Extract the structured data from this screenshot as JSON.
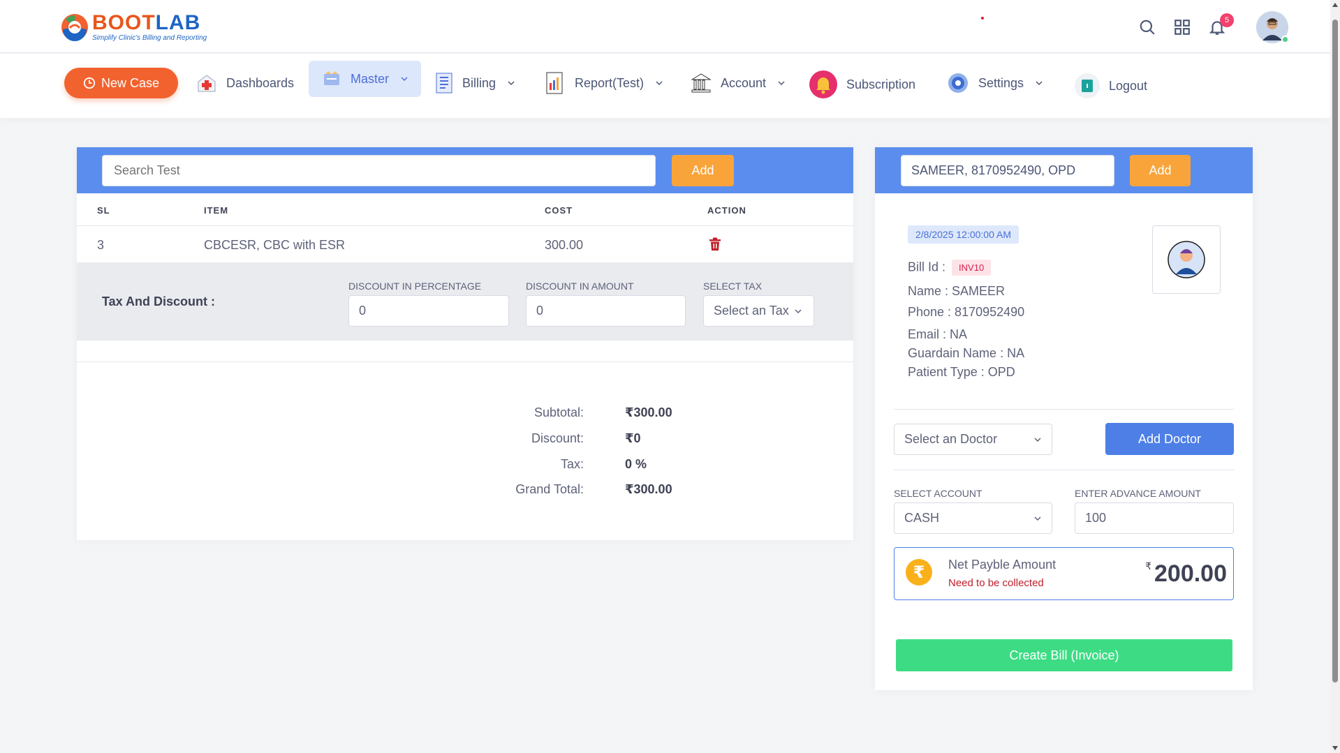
{
  "brand": {
    "name_part1": "BOOT",
    "name_part2": "LAB",
    "tagline": "Simplify Clinic's Billing and Reporting"
  },
  "header": {
    "notification_count": "5",
    "icons": [
      "search-icon",
      "grid-icon",
      "bell-icon",
      "user-avatar"
    ]
  },
  "nav": {
    "new_case": "New Case",
    "items": [
      {
        "label": "Dashboards",
        "icon": "hospital-icon"
      },
      {
        "label": "Master",
        "icon": "master-icon"
      },
      {
        "label": "Billing",
        "icon": "billing-icon"
      },
      {
        "label": "Report(Test)",
        "icon": "report-icon"
      },
      {
        "label": "Account",
        "icon": "bank-icon"
      },
      {
        "label": "Subscription",
        "icon": "bell-icon"
      },
      {
        "label": "Settings",
        "icon": "gear-icon"
      },
      {
        "label": "Logout",
        "icon": "logout-icon"
      }
    ]
  },
  "tests": {
    "search_placeholder": "Search Test",
    "add_label": "Add",
    "columns": [
      "SL",
      "ITEM",
      "COST",
      "ACTION"
    ],
    "rows": [
      {
        "sl": "3",
        "item": "CBCESR, CBC with ESR",
        "cost": "300.00"
      }
    ]
  },
  "tax": {
    "title": "Tax And Discount :",
    "discount_pct_label": "DISCOUNT IN PERCENTAGE",
    "discount_pct_value": "0",
    "discount_amt_label": "DISCOUNT IN AMOUNT",
    "discount_amt_value": "0",
    "select_tax_label": "SELECT TAX",
    "select_tax_value": "Select an Tax"
  },
  "summary": {
    "subtotal_label": "Subtotal:",
    "subtotal_value": "₹300.00",
    "discount_label": "Discount:",
    "discount_value": "₹0",
    "tax_label": "Tax:",
    "tax_value": "0 %",
    "grand_label": "Grand Total:",
    "grand_value": "₹300.00"
  },
  "patient": {
    "search_value": "SAMEER, 8170952490, OPD",
    "add_label": "Add",
    "date": "2/8/2025 12:00:00 AM",
    "bill_id_label": "Bill Id :",
    "bill_id": "INV10",
    "name": "Name : SAMEER",
    "phone": "Phone : 8170952490",
    "email": "Email : NA",
    "guardian": "Guardain Name : NA",
    "type": "Patient Type : OPD"
  },
  "doctor": {
    "select_value": "Select an Doctor",
    "add_label": "Add Doctor"
  },
  "account": {
    "select_label": "SELECT ACCOUNT",
    "select_value": "CASH",
    "advance_label": "ENTER ADVANCE AMOUNT",
    "advance_value": "100"
  },
  "net": {
    "label": "Net Payble Amount",
    "sub": "Need to be collected",
    "currency": "₹",
    "amount": "200.00"
  },
  "create_bill": "Create Bill (Invoice)",
  "colors": {
    "primary": "#5b8def",
    "orange": "#f8a43a",
    "new_case": "#f2622e",
    "green": "#3ddc84",
    "danger": "#d9214e"
  }
}
